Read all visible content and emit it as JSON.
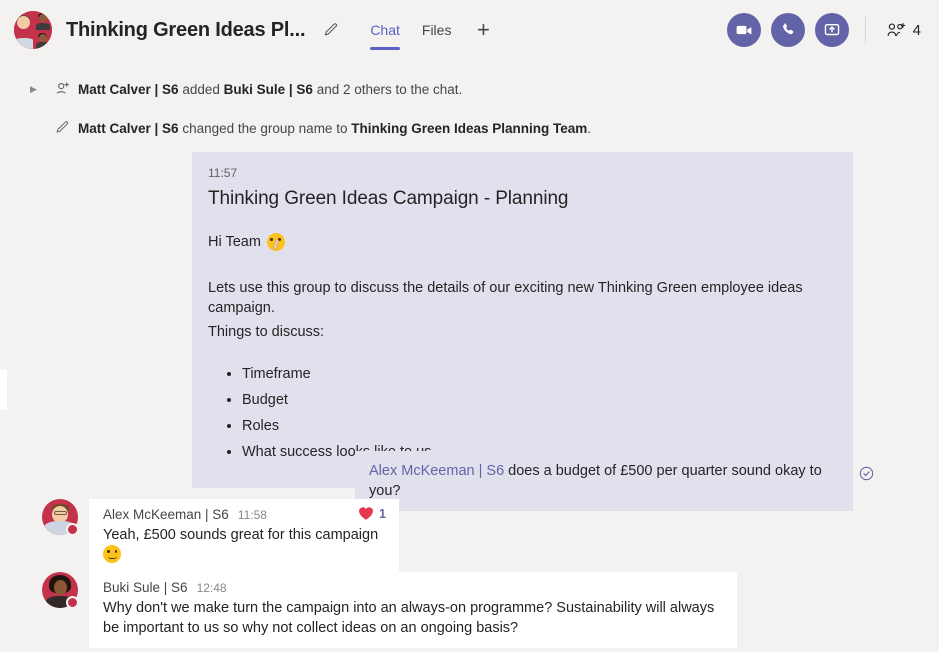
{
  "header": {
    "chat_title": "Thinking Green Ideas Pl...",
    "edit_icon": "pencil-icon",
    "tabs": [
      {
        "label": "Chat",
        "active": true
      },
      {
        "label": "Files",
        "active": false
      }
    ],
    "add_tab_label": "+",
    "actions": [
      {
        "name": "video-call-button",
        "icon": "video-camera-icon"
      },
      {
        "name": "audio-call-button",
        "icon": "phone-icon"
      },
      {
        "name": "share-screen-button",
        "icon": "share-screen-icon"
      }
    ],
    "people": {
      "icon": "add-people-icon",
      "count": "4"
    },
    "accent_color": "#6264a7",
    "tab_active_color": "#5b5fc7"
  },
  "system_messages": [
    {
      "icon": "add-person-icon",
      "actor": "Matt Calver | S6",
      "middle": " added ",
      "target": "Buki Sule | S6",
      "tail": " and 2 others to the chat."
    },
    {
      "icon": "pencil-icon",
      "actor": "Matt Calver | S6",
      "middle": " changed the group name to ",
      "target": "Thinking Green Ideas Planning Team",
      "tail": "."
    }
  ],
  "announcement_card": {
    "time": "11:57",
    "title": "Thinking Green Ideas Campaign - Planning",
    "greeting": "Hi Team",
    "greeting_emoji": "shushing-face-emoji",
    "paragraph": "Lets use this group to discuss the details of our exciting new Thinking Green employee ideas campaign.",
    "list_intro": "Things to discuss:",
    "bullets": [
      "Timeframe",
      "Budget",
      "Roles",
      "What success looks like to us"
    ],
    "background_color": "#e1e1ee"
  },
  "outgoing_message": {
    "mention": "Alex McKeeman | S6",
    "text": " does a budget of £500 per quarter sound okay to you?",
    "status_icon": "delivered-check-icon",
    "background_color": "#e1e1ee"
  },
  "incoming_messages": [
    {
      "sender": "Alex McKeeman | S6",
      "time": "11:58",
      "text": "Yeah, £500 sounds great for this campaign",
      "trailing_emoji": "smiling-face-emoji",
      "presence": "busy",
      "reaction": {
        "icon": "heart-icon",
        "count": "1",
        "color": "#e8384f"
      }
    },
    {
      "sender": "Buki Sule | S6",
      "time": "12:48",
      "text": "Why don't we make turn the campaign into an always-on programme? Sustainability will always be important to us so why not collect ideas on an ongoing basis?",
      "trailing_emoji": "",
      "presence": "busy",
      "reaction": null
    }
  ]
}
